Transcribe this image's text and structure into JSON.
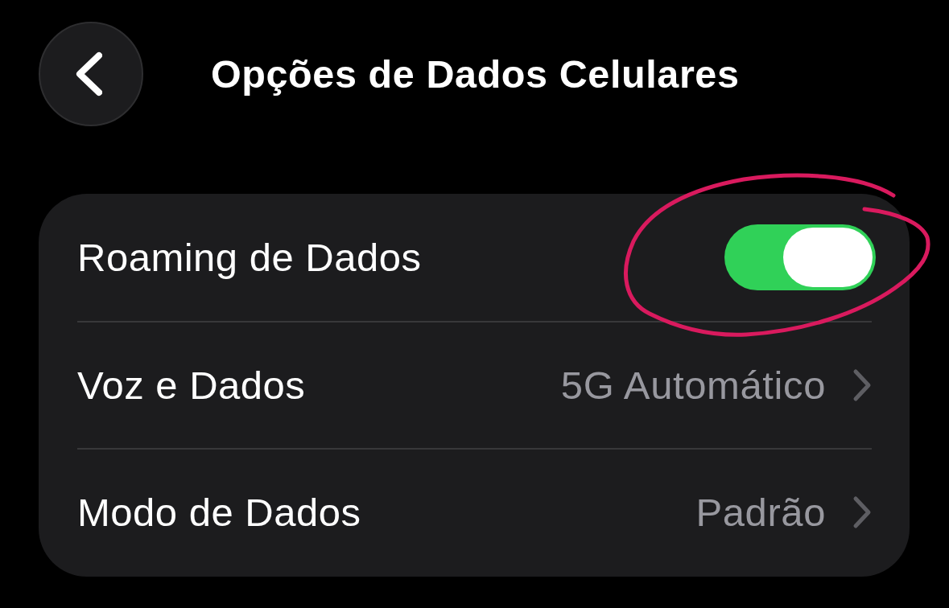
{
  "header": {
    "title": "Opções de Dados Celulares"
  },
  "rows": [
    {
      "kind": "toggle",
      "label": "Roaming de Dados",
      "on": true,
      "circled": true
    },
    {
      "kind": "link",
      "label": "Voz e Dados",
      "value": "5G Automático",
      "circled": false
    },
    {
      "kind": "link",
      "label": "Modo de Dados",
      "value": "Padrão",
      "circled": false
    }
  ]
}
